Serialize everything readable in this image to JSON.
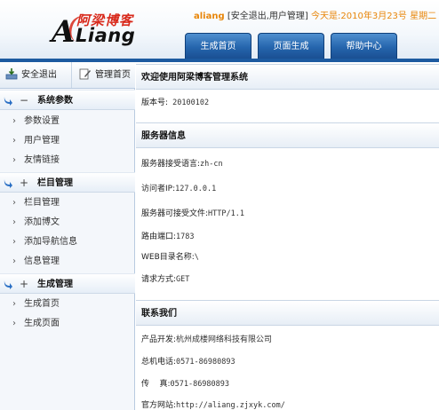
{
  "brand": {
    "cn_name": "阿梁博客",
    "logo_a": "A",
    "logo_liang": "Liang"
  },
  "user_bar": {
    "username": "aliang",
    "bracket_open": " [",
    "logout_label": "安全退出",
    "separator": ",",
    "admin_label": "用户管理",
    "bracket_close": "] ",
    "today": "今天是:2010年3月23号 星期二"
  },
  "nav": {
    "tabs": [
      {
        "label": "生成首页"
      },
      {
        "label": "页面生成"
      },
      {
        "label": "帮助中心"
      }
    ]
  },
  "sidebar": {
    "logout_label": "安全退出",
    "home_label": "管理首页",
    "groups": [
      {
        "toggle": "−",
        "title": "系统参数",
        "items": [
          "参数设置",
          "用户管理",
          "友情链接"
        ]
      },
      {
        "toggle": "+",
        "title": "栏目管理",
        "items": [
          "栏目管理",
          "添加博文",
          "添加导航信息",
          "信息管理"
        ]
      },
      {
        "toggle": "+",
        "title": "生成管理",
        "items": [
          "生成首页",
          "生成页面"
        ]
      }
    ]
  },
  "main": {
    "welcome": {
      "title": "欢迎使用阿梁博客管理系统",
      "version_label": "版本号:",
      "version_value": " 20100102"
    },
    "server": {
      "title": "服务器信息",
      "rows": [
        {
          "label": "服务器接受语言:",
          "value": "zh-cn"
        },
        {
          "label": "访问者IP:",
          "value": "127.0.0.1"
        },
        {
          "label": "服务器可接受文件:",
          "value": "HTTP/1.1"
        },
        {
          "label": "路由端口:",
          "value": "1783"
        },
        {
          "label": "WEB目录名称:",
          "value": "\\"
        },
        {
          "label": "请求方式:",
          "value": "GET"
        }
      ]
    },
    "contact": {
      "title": "联系我们",
      "rows": [
        {
          "label": "产品开发:",
          "value": "杭州成楼网络科技有限公司"
        },
        {
          "label": "总机电话:",
          "value": "0571-86980893"
        },
        {
          "label": "传    真:",
          "value": "0571-86980893"
        },
        {
          "label": "官方网站:",
          "value": "http://aliang.zjxyk.com/"
        }
      ]
    }
  },
  "colors": {
    "accent_orange": "#e8860a",
    "nav_blue": "#2565ad",
    "logo_red": "#d8291b"
  }
}
